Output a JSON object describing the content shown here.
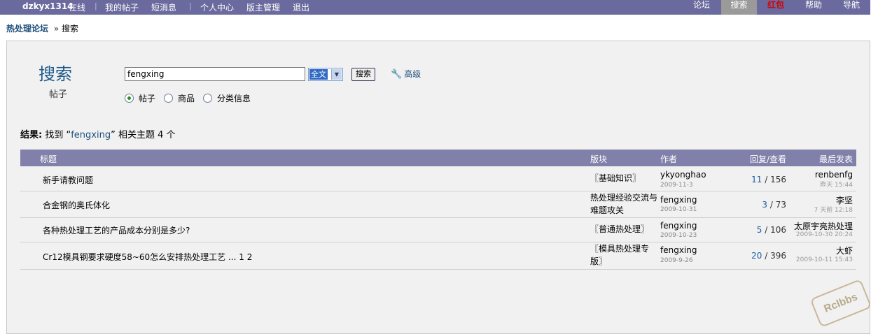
{
  "topbar": {
    "username": "dzkyx1314",
    "status": "在线",
    "links": [
      "我的帖子",
      "短消息",
      "个人中心",
      "版主管理",
      "退出"
    ],
    "right_tabs": [
      "论坛",
      "搜索",
      "红包",
      "帮助",
      "导航"
    ]
  },
  "breadcrumb": {
    "home": "热处理论坛",
    "separator": "»",
    "current": "搜索"
  },
  "search": {
    "title": "搜索",
    "subtitle": "帖子",
    "query": "fengxing",
    "scope": "全文",
    "button": "搜索",
    "advanced": "高级",
    "types": [
      "帖子",
      "商品",
      "分类信息"
    ],
    "selected_type": "帖子"
  },
  "result": {
    "label": "结果:",
    "prefix": "找到 “",
    "keyword": "fengxing",
    "suffix": "” 相关主题 4 个"
  },
  "table": {
    "headers": {
      "title": "标题",
      "board": "版块",
      "author": "作者",
      "stats": "回复/查看",
      "last": "最后发表"
    },
    "rows": [
      {
        "title": "新手请教问题",
        "board": "〖基础知识〗",
        "author": "ykyonghao",
        "date": "2009-11-3",
        "replies": "11",
        "views": "156",
        "last_user": "renbenfg",
        "last_date": "昨天 15:44"
      },
      {
        "title": "合金钢的奥氏体化",
        "board": "热处理经验交流与难题攻关",
        "board_l1": "热处理经验交流与",
        "board_l2": "难题攻关",
        "author": "fengxing",
        "date": "2009-10-31",
        "replies": "3",
        "views": "73",
        "last_user": "李坚",
        "last_date": "7 天前 12:18"
      },
      {
        "title": "各种热处理工艺的产品成本分别是多少?",
        "board": "〖普通热处理〗",
        "author": "fengxing",
        "date": "2009-10-23",
        "replies": "5",
        "views": "106",
        "last_user": "太原宇亮热处理",
        "last_date": "2009-10-30 20:24"
      },
      {
        "title": "Cr12模具钢要求硬度58~60怎么安排热处理工艺 ... 1 2",
        "board": "〖模具热处理专版〗",
        "board_l1": "〖模具热处理专",
        "board_l2": "版〗",
        "author": "fengxing",
        "date": "2009-9-26",
        "replies": "20",
        "views": "396",
        "last_user": "大虾",
        "last_date": "2009-10-11 15:43"
      }
    ]
  },
  "watermark": "Rclbbs",
  "colors": {
    "nav_bg": "#6b6a9e",
    "header_bg": "#8080aa",
    "link": "#1d4e7d",
    "active_tab": "#9a9a9a",
    "red_tab": "#d40000"
  }
}
